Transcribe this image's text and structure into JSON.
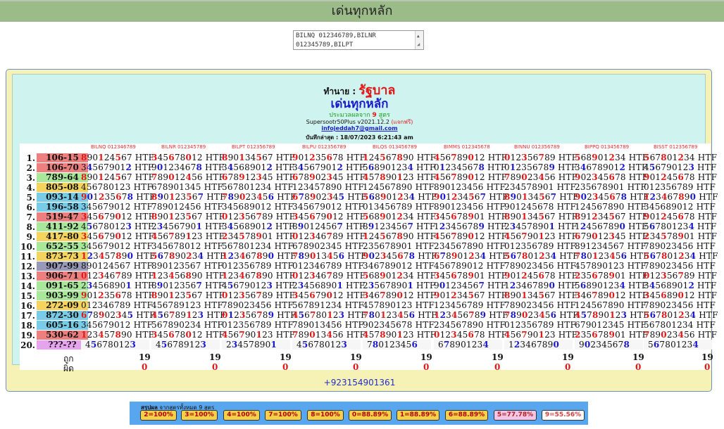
{
  "header": {
    "title": "เด่นทุกหลัก"
  },
  "textarea": {
    "line1": "BILNQ 012346789,BILNR",
    "line2": "012345789,BILPT"
  },
  "panel": {
    "predictor_label": "ทำนาย : ",
    "predictor_name": "รัฐบาล",
    "title": "เด่นทุกหลัก",
    "subtitle_pre": "ประมวลผลจาก ",
    "subtitle_num": "9",
    "subtitle_post": " สูตร",
    "version": "Supersootr50Plus v2021.12.2 ",
    "free_tag": "(แจกฟรี)",
    "email": "infojeddah7@gmail.com",
    "updated": "บันทึกล่าสุด : 18/07/2023 6:21:43 am",
    "contact": "+923154901361"
  },
  "colors": {
    "red": "#e01818",
    "blue": "#1a1acc",
    "panel": "#f6f1b4",
    "inner": "#cff3ee"
  },
  "formulas": [
    "BILNQ 012346789",
    "BILNR 012345789",
    "BILPT 012356789",
    "BILPU 012356789",
    "BILQS 013456789",
    "BIMMS 012345678",
    "BINNU 012356789",
    "BIPPQ 013456789",
    "BISST 012356789"
  ],
  "rows": [
    {
      "idx": "1.",
      "num": "106-15",
      "color": "#ee7f7f",
      "cells": [
        "890124567 HTF",
        "345678012 HTF",
        "890134567 HTF",
        "901235678 HTF",
        "124567890 HTF",
        "456789012 HTF",
        "012356789 HTF",
        "568901234 HTF",
        "567801234 HTF"
      ]
    },
    {
      "idx": "2.",
      "num": "106-70",
      "color": "#ee7f7f",
      "cells": [
        "345679012 HTF",
        "901234678 HTF",
        "345689012 HTF",
        "345679012 HTF",
        "568901234 HTF",
        "012345678 HTF",
        "012356789 HTF",
        "346789012 HTF",
        "456790123 HTF"
      ]
    },
    {
      "idx": "3.",
      "num": "789-64",
      "color": "#a9e89b",
      "cells": [
        "890124567 HTF",
        "789012456 HTF",
        "678912345 HTF",
        "678902345 HTF",
        "457890123 HTF",
        "456789012 HTF",
        "789023456 HTF",
        "902345678 HTF",
        "901245678 HTF"
      ]
    },
    {
      "idx": "4.",
      "num": "805-08",
      "color": "#f4d45e",
      "cells": [
        "456780123 HTF",
        "678901345 HTF",
        "567801234 HTF",
        "123457890 HTF",
        "124567890 HTF",
        "890123456 HTF",
        "234578901 HTF",
        "235678901 HTF",
        "012356789 HTF"
      ]
    },
    {
      "idx": "5.",
      "num": "093-14",
      "color": "#78cce8",
      "cells": [
        "901235678 HTF",
        "890123567 HTF",
        "789023456 HTF",
        "678902345 HTF",
        "568901234 HTF",
        "901234567 HTF",
        "890134567 HTF",
        "902345678 HTF",
        "123467890 HTF"
      ]
    },
    {
      "idx": "6.",
      "num": "196-58",
      "color": "#78cce8",
      "cells": [
        "345679012 HTF",
        "789012456 HTF",
        "345689012 HTF",
        "345679012 HTF",
        "013456789 HTF",
        "890123456 HTF",
        "901245678 HTF",
        "124567890 HTF",
        "345689012 HTF"
      ]
    },
    {
      "idx": "7.",
      "num": "519-47",
      "color": "#ee7f7f",
      "cells": [
        "345679012 HTF",
        "890123567 HTF",
        "012356789 HTF",
        "345679012 HTF",
        "568901234 HTF",
        "345678901 HTF",
        "890134567 HTF",
        "891234567 HTF",
        "901245678 HTF"
      ]
    },
    {
      "idx": "8.",
      "num": "411-92",
      "color": "#a9e89b",
      "cells": [
        "456780123 HTF",
        "234567901 HTF",
        "345689012 HTF",
        "890124567 HTF",
        "891234567 HTF",
        "123456789 HTF",
        "234578901 HTF",
        "124567890 HTF",
        "567801234 HTF"
      ]
    },
    {
      "idx": "9.",
      "num": "417-80",
      "color": "#f4d45e",
      "cells": [
        "345679012 HTF",
        "456789123 HTF",
        "234578901 HTF",
        "012346789 HTF",
        "124567890 HTF",
        "456789012 HTF",
        "456790123 HTF",
        "679012345 HTF",
        "234578901 HTF"
      ]
    },
    {
      "idx": "10.",
      "num": "652-55",
      "color": "#a9e89b",
      "cells": [
        "345679012 HTF",
        "345678012 HTF",
        "567801234 HTF",
        "678902345 HTF",
        "235678901 HTF",
        "234567890 HTF",
        "012356789 HTF",
        "891234567 HTF",
        "789023456 HTF"
      ]
    },
    {
      "idx": "11.",
      "num": "873-73",
      "color": "#f4d45e",
      "cells": [
        "123457890 HTF",
        "567890234 HTF",
        "123467890 HTF",
        "789013456 HTF",
        "902345678 HTF",
        "678901234 HTF",
        "567801234 HTF",
        "780123456 HTF",
        "567801234 HTF"
      ]
    },
    {
      "idx": "12.",
      "num": "907-99",
      "color": "#9898b8",
      "cells": [
        "890124567 HTF",
        "890123567 HTF",
        "012356789 HTF",
        "012346789 HTF",
        "346789012 HTF",
        "456789012 HTF",
        "789023456 HTF",
        "457890123 HTF",
        "789023456 HTF"
      ]
    },
    {
      "idx": "13.",
      "num": "906-71",
      "color": "#ee7f7f",
      "cells": [
        "012346789 HTF",
        "123456890 HTF",
        "123467890 HTF",
        "012346789 HTF",
        "568901234 HTF",
        "345678901 HTF",
        "901245678 HTF",
        "235678901 HTF",
        "012356789 HTF"
      ]
    },
    {
      "idx": "14.",
      "num": "091-65",
      "color": "#a9e89b",
      "cells": [
        "234568901 HTF",
        "890123567 HTF",
        "456790123 HTF",
        "234568901 HTF",
        "235678901 HTF",
        "901234567 HTF",
        "123467890 HTF",
        "568901234 HTF",
        "345689012 HTF"
      ]
    },
    {
      "idx": "15.",
      "num": "903-99",
      "color": "#a9e89b",
      "cells": [
        "901235678 HTF",
        "890123567 HTF",
        "012356789 HTF",
        "345679012 HTF",
        "346789012 HTF",
        "901234567 HTF",
        "890134567 HTF",
        "346789012 HTF",
        "345689012 HTF"
      ]
    },
    {
      "idx": "16.",
      "num": "272-09",
      "color": "#f4d45e",
      "cells": [
        "012346789 HTF",
        "456789123 HTF",
        "789023456 HTF",
        "567891234 HTF",
        "457890123 HTF",
        "123456789 HTF",
        "789023456 HTF",
        "124567890 HTF",
        "789023456 HTF"
      ]
    },
    {
      "idx": "17.",
      "num": "872-30",
      "color": "#78cce8",
      "cells": [
        "678902345 HTF",
        "456789123 HTF",
        "012356789 HTF",
        "456780123 HTF",
        "780123456 HTF",
        "123456789 HTF",
        "789023456 HTF",
        "457890123 HTF",
        "567801234 HTF"
      ]
    },
    {
      "idx": "18.",
      "num": "605-16",
      "color": "#78cce8",
      "cells": [
        "345679012 HTF",
        "567890234 HTF",
        "012356789 HTF",
        "789013456 HTF",
        "902345678 HTF",
        "234567890 HTF",
        "012356789 HTF",
        "679012345 HTF",
        "567801234 HTF"
      ]
    },
    {
      "idx": "19.",
      "num": "530-62",
      "color": "#ee7f7f",
      "cells": [
        "123457890 HTF",
        "345678012 HTF",
        "456790123 HTF",
        "789013456 HTF",
        "457890123 HTF",
        "012345678 HTF",
        "456790123 HTF",
        "235678901 HTF",
        "789023456 HTF"
      ]
    },
    {
      "idx": "20.",
      "num": "???-??",
      "color": "#e6a4ee",
      "cells": [
        "456780123",
        "456789123",
        "234578901",
        "456780123",
        "780123456",
        "678901234",
        "123467890",
        "902345678",
        "567801234"
      ]
    }
  ],
  "totals": {
    "correct_label": "ถูก",
    "wrong_label": "ผิด",
    "correct": [
      "19",
      "19",
      "19",
      "19",
      "19",
      "19",
      "19",
      "19",
      "19"
    ],
    "wrong": [
      "0",
      "0",
      "0",
      "0",
      "0",
      "0",
      "0",
      "0",
      "0"
    ]
  },
  "summary": {
    "title_bold": "สรุปผล",
    "title_rest": " จากสูตรทั้งหมด 9 สูตร",
    "badges": [
      {
        "label": "2=100%",
        "bg": "#f5d04b"
      },
      {
        "label": "3=100%",
        "bg": "#f5d04b"
      },
      {
        "label": "4=100%",
        "bg": "#f5d04b"
      },
      {
        "label": "7=100%",
        "bg": "#f5d04b"
      },
      {
        "label": "8=100%",
        "bg": "#f5d04b"
      },
      {
        "label": "0=88.89%",
        "bg": "#f5d04b"
      },
      {
        "label": "1=88.89%",
        "bg": "#f5d04b"
      },
      {
        "label": "6=88.89%",
        "bg": "#f5d04b"
      },
      {
        "label": "5=77.78%",
        "bg": "#f2c6e6"
      },
      {
        "label": "9=55.56%",
        "bg": "#ffffff"
      }
    ]
  }
}
